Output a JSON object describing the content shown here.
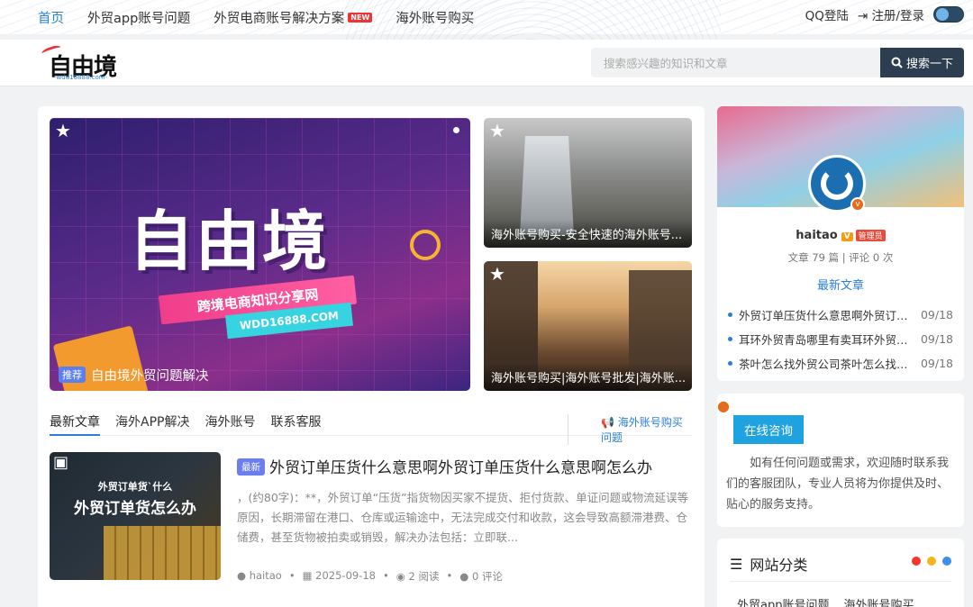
{
  "nav": {
    "items": [
      "首页",
      "外贸app账号问题",
      "外贸电商账号解决方案",
      "海外账号购买"
    ],
    "new_tag": "NEW"
  },
  "auth": {
    "qq": "QQ登陆",
    "register": "注册/登录"
  },
  "logo": {
    "text": "自由境",
    "sub": "-wdd16888.com-"
  },
  "search": {
    "placeholder": "搜索感兴趣的知识和文章",
    "button": "搜索一下"
  },
  "hero": {
    "big_text": "自由境",
    "band_text": "跨境电商知识分享网",
    "url_text": "WDD16888.COM",
    "tag": "推荐",
    "caption": "自由境外贸问题解决"
  },
  "thumbs": [
    {
      "caption": "海外账号购买-安全快速的海外账号..."
    },
    {
      "caption": "海外账号购买|海外账号批发|海外账..."
    }
  ],
  "tabs": {
    "items": [
      "最新文章",
      "海外APP解决",
      "海外账号",
      "联系客服"
    ],
    "right_link": "海外账号购买问题"
  },
  "post": {
    "image_line1": "外贸订单货`什么",
    "image_line2": "外贸订单货怎么办",
    "badge": "最新",
    "title": "外贸订单压货什么意思啊外贸订单压货什么意思啊怎么办",
    "excerpt": "，(约80字)：**，外贸订单“压货”指货物因买家不提货、拒付货款、单证问题或物流延误等原因，长期滞留在港口、仓库或运输途中，无法完成交付和收款，这会导致高额滞港费、仓储费，甚至货物被拍卖或销毁，解决办法包括：立即联...",
    "author": "haitao",
    "date": "2025-09-18",
    "reads": "2 阅读",
    "comments": "0 评论"
  },
  "profile": {
    "name": "haitao",
    "v": "V",
    "role": "管理员",
    "stats": "文章 79 篇 | 评论 0 次",
    "latest_label": "最新文章",
    "latest": [
      {
        "title": "外贸订单压货什么意思啊外贸订单压货什么意思啊怎么办",
        "date": "09/18"
      },
      {
        "title": "耳环外贸青岛哪里有卖耳环外贸青岛哪里有卖",
        "date": "09/18"
      },
      {
        "title": "茶叶怎么找外贸公司茶叶怎么找外贸公司",
        "date": "09/18"
      }
    ]
  },
  "consult": {
    "button": "在线咨询",
    "text": "如有任何问题或需求，欢迎随时联系我们的客服团队，专业人员将为你提供及时、贴心的服务支持。"
  },
  "categories": {
    "title": "网站分类",
    "dot_colors": [
      "#f5362e",
      "#f5b51c",
      "#3f8fe6"
    ],
    "items": [
      "外贸app账号问题",
      "海外账号购买"
    ]
  }
}
